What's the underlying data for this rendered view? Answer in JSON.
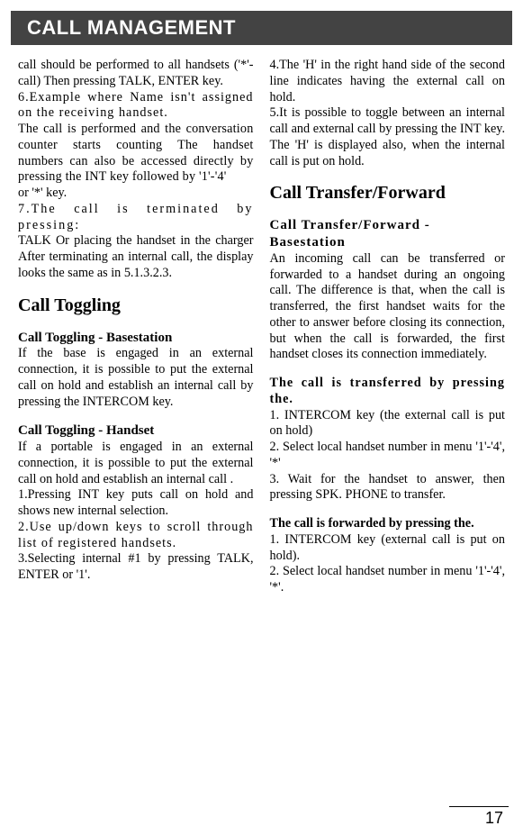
{
  "banner": "CALL MANAGEMENT",
  "left": {
    "p1a": "call should be performed to all handsets ('*'-call) Then pressing TALK, ENTER key.",
    "p1b": "6.Example where Name isn't assigned on the receiving handset.",
    "p1c": "The call is performed and the conversation counter starts counting The handset numbers can also be accessed directly by pressing the INT key followed by '1'-'4'",
    "p1d": "or '*' key.",
    "p1e": "7.The call is terminated by pressing:",
    "p1f": "TALK Or placing the handset in the charger After terminating an internal call, the display looks the same as in 5.1.3.2.3.",
    "h2a": "Call Toggling",
    "h3a": "Call Toggling - Basestation",
    "p2a": "If the base is engaged in an external connection, it is possible to put the external call on hold and establish an internal call by pressing the INTERCOM key.",
    "h3b": "Call Toggling - Handset",
    "p3a": "If a portable is engaged in an external connection, it is possible to put the external call on hold and establish an internal call .",
    "p3b": "1.Pressing INT key puts call on hold and shows new internal selection.",
    "p3c": "2.Use up/down keys to scroll through list of registered handsets.",
    "p3d": "3.Selecting internal #1 by pressing TALK, ENTER or '1'."
  },
  "right": {
    "p1a": "4.The 'H' in the right hand side of the second line indicates having the external call on hold.",
    "p1b": "5.It is possible to toggle between an internal call and external call by pressing the INT key. The 'H' is displayed also, when the internal call is put on hold.",
    "h2a": "Call Transfer/Forward",
    "h3a": "Call Transfer/Forward - Basestation",
    "p2a": "An incoming call can be transferred or forwarded to a handset during an ongoing call. The difference is that, when the call is transferred, the first handset waits for the other to answer before closing its connection, but when the call is forwarded, the first handset closes its connection immediately.",
    "h3b": "The call is transferred by pressing the.",
    "p3a": "1. INTERCOM key (the external call is put on hold)",
    "p3b": "2. Select local handset number in menu '1'-'4', '*'",
    "p3c": "3. Wait for the handset to answer, then pressing SPK. PHONE to transfer.",
    "h3c": "The call is forwarded by pressing the.",
    "p4a": "1. INTERCOM key (external call is put on hold).",
    "p4b": "2. Select local handset number in menu '1'-'4', '*'."
  },
  "page_number": "17"
}
